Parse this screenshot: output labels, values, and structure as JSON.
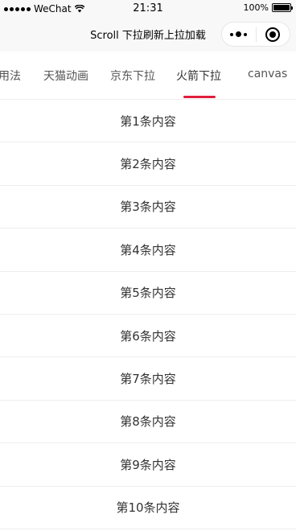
{
  "status_bar": {
    "carrier": "WeChat",
    "time": "21:31",
    "battery_percent": "100%",
    "battery_level": 1.0
  },
  "nav": {
    "title": "Scroll 下拉刷新上拉加载"
  },
  "tabs": [
    {
      "label": "用法",
      "active": false
    },
    {
      "label": "天猫动画",
      "active": false
    },
    {
      "label": "京东下拉",
      "active": false
    },
    {
      "label": "火箭下拉",
      "active": true
    },
    {
      "label": "canvas",
      "active": false
    }
  ],
  "accent_color": "#e01e3c",
  "list_items": [
    "第1条内容",
    "第2条内容",
    "第3条内容",
    "第4条内容",
    "第5条内容",
    "第6条内容",
    "第7条内容",
    "第8条内容",
    "第9条内容",
    "第10条内容"
  ]
}
